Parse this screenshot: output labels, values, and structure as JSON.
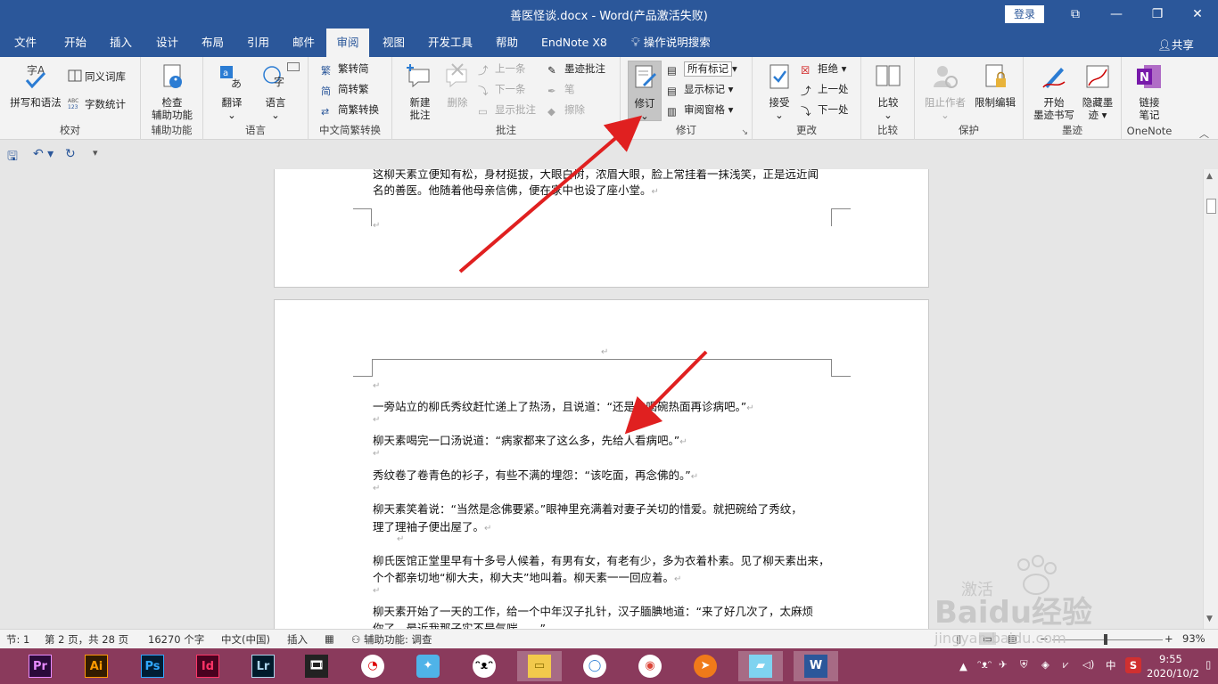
{
  "window": {
    "title": "善医怪谈.docx  -  Word(产品激活失败)",
    "login": "登录",
    "controls": {
      "ribbon_display": "⧉",
      "minimize": "—",
      "restore": "❐",
      "close": "✕"
    }
  },
  "tabs": [
    "文件",
    "开始",
    "插入",
    "设计",
    "布局",
    "引用",
    "邮件",
    "审阅",
    "视图",
    "开发工具",
    "帮助",
    "EndNote X8",
    "操作说明搜索"
  ],
  "active_tab": "审阅",
  "share": "共享",
  "ribbon": {
    "proofing": {
      "label": "校对",
      "spelling": "拼写和语法",
      "thesaurus": "同义词库",
      "wordcount": "字数统计"
    },
    "accessibility": {
      "label": "辅助功能",
      "check": [
        "检查",
        "辅助功能"
      ]
    },
    "language": {
      "label": "语言",
      "translate": "翻译",
      "lang": "语言"
    },
    "chinese": {
      "label": "中文简繁转换",
      "to_trad": "繁转简",
      "to_simp": "简转繁",
      "convert": "简繁转换"
    },
    "comments": {
      "label": "批注",
      "new": [
        "新建",
        "批注"
      ],
      "delete": "删除",
      "prev": "上一条",
      "next": "下一条",
      "show": "显示批注",
      "ink": "墨迹批注",
      "pen": "笔",
      "eraser": "擦除"
    },
    "tracking": {
      "label": "修订",
      "track": "修订",
      "markup_select": "所有标记",
      "show_markup": "显示标记",
      "review_pane": "审阅窗格"
    },
    "changes": {
      "label": "更改",
      "accept": "接受",
      "reject": "拒绝",
      "prev": "上一处",
      "next": "下一处"
    },
    "compare": {
      "label": "比较",
      "compare": "比较"
    },
    "protect": {
      "label": "保护",
      "block": "阻止作者",
      "restrict": "限制编辑"
    },
    "ink": {
      "label": "墨迹",
      "start": [
        "开始",
        "墨迹书写"
      ],
      "hide": [
        "隐藏墨",
        "迹"
      ]
    },
    "onenote": {
      "label": "OneNote",
      "link": [
        "链接",
        "笔记"
      ]
    }
  },
  "document": {
    "page1_lines": [
      "这柳天素立便知有松，身材挺拔，大眼白树，浓眉大眼，脸上常挂着一抹浅笑，正是远近闻",
      "名的善医。他随着他母亲信佛，便在家中也设了座小堂。"
    ],
    "page2_lines": [
      "一旁站立的柳氏秀纹赶忙递上了热汤，且说道：“还是先喝碗热面再诊病吧。”",
      "柳天素喝完一口汤说道：“病家都来了这么多，先给人看病吧。”",
      "秀纹卷了卷青色的衫子，有些不满的埋怨：“该吃面，再念佛的。”",
      "柳天素笑着说：“当然是念佛要紧。”眼神里充满着对妻子关切的惜爱。就把碗给了秀纹，",
      "理了理袖子便出屋了。",
      "柳氏医馆正堂里早有十多号人候着，有男有女，有老有少，多为衣着朴素。见了柳天素出来，",
      "个个都亲切地“柳大夫，柳大夫”地叫着。柳天素一一回应着。",
      "柳天素开始了一天的工作，给一个中年汉子扎针，汉子腼腆地道：“来了好几次了，太麻烦",
      "你了，最近我那子实不是气喘……”"
    ],
    "para_mark": "↵"
  },
  "status": {
    "section": "节: 1",
    "page": "第 2 页，共 28 页",
    "words": "16270 个字",
    "lang": "中文(中国)",
    "mode": "插入",
    "accessibility": "辅助功能: 调查",
    "zoom": "93%",
    "zoom_minus": "−",
    "zoom_plus": "+"
  },
  "taskbar": {
    "apps": [
      "Pr",
      "Ai",
      "Ps",
      "Id",
      "Lr"
    ],
    "time": "9:55",
    "date": "2020/10/2",
    "ime": "中"
  },
  "watermark": {
    "activate": "激活",
    "brand": "Baidu经验",
    "url": "jingyan.baidu.com"
  },
  "colors": {
    "word_blue": "#2b579a",
    "taskbar": "#8a3a5c",
    "arrow": "#e02020"
  }
}
